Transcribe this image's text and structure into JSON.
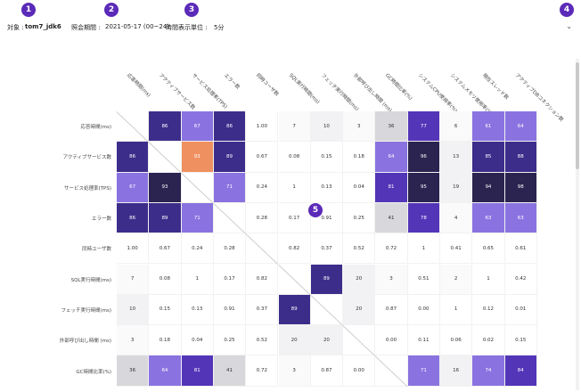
{
  "filters": {
    "target_label": "対象 :",
    "target_value": "tom7_jdk6",
    "period_label": "照会期間 :",
    "period_value": "2021-05-17 (00~24)",
    "unit_label": "時間表示単位 :",
    "unit_value": "5分"
  },
  "badges": [
    "1",
    "2",
    "3",
    "4",
    "5"
  ],
  "matrix": {
    "columns": [
      "応答時間(ms)",
      "アクティブサービス数",
      "サービス処理率(TPS)",
      "エラー数",
      "同時ユーザ数",
      "SQL実行時間(ms)",
      "フェッチ実行時間(ms)",
      "外部呼び出し時間 (ms)",
      "GC時間比率(%)",
      "システムCPU使用率(%)",
      "システムメモリ使用率(%)",
      "現在スレッド数",
      "アクティブDBコネクション数"
    ],
    "rows": [
      {
        "label": "応答時間(ms)",
        "cells": [
          "",
          "86",
          "67",
          "86",
          "1.00",
          "7",
          "10",
          "3",
          "36",
          "77",
          "6",
          "61",
          "64"
        ]
      },
      {
        "label": "アクティブサービス数",
        "cells": [
          "86",
          "",
          "93",
          "89",
          "0.67",
          "0.08",
          "0.15",
          "0.18",
          "64",
          "96",
          "13",
          "85",
          "88"
        ]
      },
      {
        "label": "サービス処理率(TPS)",
        "cells": [
          "67",
          "93",
          "",
          "71",
          "0.24",
          "1",
          "0.13",
          "0.04",
          "81",
          "95",
          "19",
          "94",
          "98"
        ]
      },
      {
        "label": "エラー数",
        "cells": [
          "86",
          "89",
          "71",
          "",
          "0.28",
          "0.17",
          "0.91",
          "0.25",
          "41",
          "78",
          "4",
          "63",
          "63"
        ]
      },
      {
        "label": "同時ユーザ数",
        "cells": [
          "1.00",
          "0.67",
          "0.24",
          "0.28",
          "",
          "0.82",
          "0.37",
          "0.52",
          "0.72",
          "1",
          "0.41",
          "0.65",
          "0.61"
        ]
      },
      {
        "label": "SQL実行時間(ms)",
        "cells": [
          "7",
          "0.08",
          "1",
          "0.17",
          "0.82",
          "",
          "89",
          "20",
          "3",
          "0.51",
          "2",
          "1",
          "0.42"
        ]
      },
      {
        "label": "フェッチ実行時間(ms)",
        "cells": [
          "10",
          "0.15",
          "0.13",
          "0.91",
          "0.37",
          "89",
          "",
          "20",
          "0.87",
          "0.00",
          "1",
          "0.12",
          "0.01"
        ]
      },
      {
        "label": "外部呼び出し時間 (ms)",
        "cells": [
          "3",
          "0.18",
          "0.04",
          "0.25",
          "0.52",
          "20",
          "20",
          "",
          "0.00",
          "0.11",
          "0.06",
          "0.02",
          "0.15"
        ]
      },
      {
        "label": "GC時間比率(%)",
        "cells": [
          "36",
          "64",
          "81",
          "41",
          "0.72",
          "3",
          "0.87",
          "0.00",
          "",
          "71",
          "16",
          "74",
          "84"
        ]
      }
    ]
  },
  "colors": {
    "accent": "#5b2ab8",
    "orange": "#ef9060"
  }
}
